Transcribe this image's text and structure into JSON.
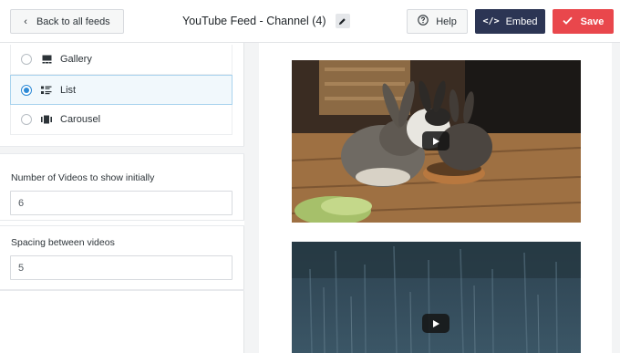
{
  "header": {
    "back_label": "Back to all feeds",
    "title": "YouTube Feed - Channel (4)",
    "help_label": "Help",
    "embed_label": "Embed",
    "save_label": "Save"
  },
  "layout": {
    "options": [
      {
        "label": "Gallery",
        "icon": "gallery-icon",
        "selected": false
      },
      {
        "label": "List",
        "icon": "list-icon",
        "selected": true
      },
      {
        "label": "Carousel",
        "icon": "carousel-icon",
        "selected": false
      }
    ]
  },
  "settings": {
    "num_videos_label": "Number of Videos to show initially",
    "num_videos_value": "6",
    "spacing_label": "Spacing between videos",
    "spacing_value": "5"
  },
  "preview": {
    "videos": [
      {
        "thumbnail": "rabbits eating from a bowl",
        "icon": "play-icon"
      },
      {
        "thumbnail": "rain on a window",
        "icon": "play-icon"
      }
    ]
  },
  "colors": {
    "embed_bg": "#2c3554",
    "save_bg": "#e9474c",
    "accent": "#2d8ad6",
    "selected_bg": "#f1f8fc"
  }
}
